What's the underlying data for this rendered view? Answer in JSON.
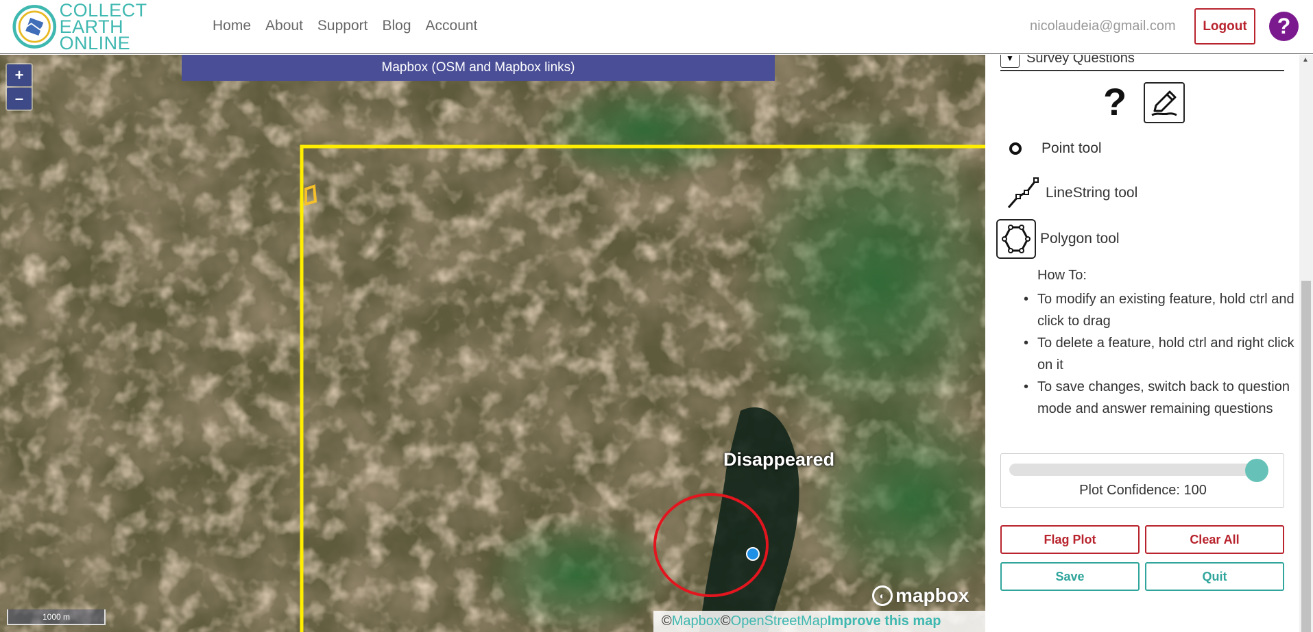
{
  "navbar": {
    "brand_line1": "COLLECT EARTH",
    "brand_line2": "ONLINE",
    "links": [
      "Home",
      "About",
      "Support",
      "Blog",
      "Account"
    ],
    "user_email": "nicolaudeia@gmail.com",
    "logout_label": "Logout",
    "help_label": "?"
  },
  "map": {
    "zoom_in": "+",
    "zoom_out": "–",
    "imagery_banner": "Mapbox (OSM and Mapbox links)",
    "feature_label": "Disappeared",
    "scale_label": "1000 m",
    "mapbox_logo": "mapbox",
    "attribution": {
      "copyright1": "© ",
      "mapbox_link": "Mapbox",
      "copyright2": "© ",
      "osm_link": "OpenStreetMap",
      "improve_link": "Improve this map"
    },
    "colors": {
      "plot_boundary": "#ffee00",
      "annotation_circle": "#e3151e",
      "point_marker": "#1e90e6"
    }
  },
  "sidebar": {
    "survey_header": "Survey Questions",
    "question_mode_label": "?",
    "tools": {
      "point": "Point tool",
      "line": "LineString tool",
      "polygon": "Polygon tool"
    },
    "howto_title": "How To:",
    "howto_items": [
      "To modify an existing feature, hold ctrl and click to drag",
      "To delete a feature, hold ctrl and right click on it",
      "To save changes, switch back to question mode and answer remaining questions"
    ],
    "confidence": {
      "label": "Plot Confidence: 100",
      "value": 100,
      "max": 100
    },
    "buttons": {
      "flag": "Flag Plot",
      "clear": "Clear All",
      "save": "Save",
      "quit": "Quit"
    }
  }
}
